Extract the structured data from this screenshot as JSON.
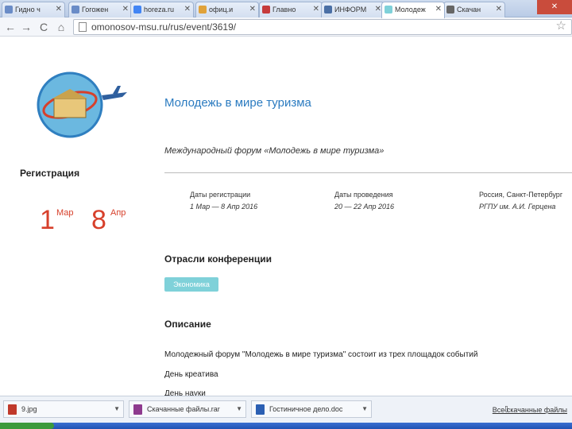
{
  "tabs": [
    {
      "label": "Гидно ч"
    },
    {
      "label": "Гогожен"
    },
    {
      "label": "horeza.ru"
    },
    {
      "label": "офиц.и"
    },
    {
      "label": "Главно"
    },
    {
      "label": "ИНФОРМ"
    },
    {
      "label": "Молодеж"
    },
    {
      "label": "Скачан"
    }
  ],
  "tab_close_glyph": "✕",
  "address": {
    "url": "omonosov-msu.ru/rus/event/3619/",
    "star_glyph": "☆"
  },
  "nav": {
    "back": "←",
    "forward": "→",
    "reload": "C",
    "home": "⌂"
  },
  "sidebar": {
    "registration_title": "Регистрация",
    "start_day": "1",
    "start_month": "Мар",
    "end_day": "8",
    "end_month": "Апр"
  },
  "event": {
    "title": "Молодежь в мире туризма",
    "subtitle": "Международный форум «Молодежь в мире туризма»",
    "info": [
      {
        "label": "Даты регистрации",
        "value": "1 Мар — 8 Апр 2016"
      },
      {
        "label": "Даты проведения",
        "value": "20 — 22 Апр 2016"
      },
      {
        "label": "Россия, Санкт-Петербург",
        "value": "РГПУ им. А.И. Герцена"
      }
    ],
    "industries_title": "Отрасли конференции",
    "industry_tag": "Экономика",
    "description_title": "Описание",
    "description_lines": [
      "Молодежный форум \"Молодежь в мире туризма\" состоит из трех площадок событий",
      "День креатива",
      "День науки"
    ]
  },
  "downloads": {
    "items": [
      {
        "label": "9.jpg"
      },
      {
        "label": "Скачанные файлы.rar"
      },
      {
        "label": "Гостиничное дело.doc"
      }
    ],
    "caret": "▼",
    "show_all_label": "Все скачанные файлы",
    "show_all_icon": "⇩"
  },
  "colors": {
    "accent": "#2b7bc0",
    "date_red": "#d7402b",
    "tag_bg": "#7fd1d9"
  }
}
